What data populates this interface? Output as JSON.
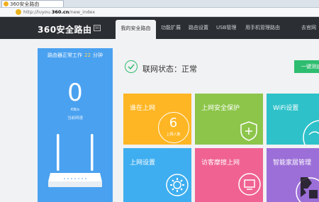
{
  "browser": {
    "tab_title": "360安全路由",
    "url_prefix": "http://luyou.",
    "url_domain": "360.cn",
    "url_path": "/new_index"
  },
  "header": {
    "logo_text": "360安全路由",
    "version_badge": "90",
    "nav": [
      "我的安全路由",
      "功能扩展",
      "路由设置",
      "USB管理",
      "用手机管理路由"
    ],
    "active_nav_index": 0,
    "user_link": "去官网"
  },
  "status": {
    "run_label": "路由器正常工作",
    "run_minutes": "22",
    "run_unit": "分钟",
    "speed_value": "0",
    "speed_unit": "KB/s",
    "speed_label": "当前网速"
  },
  "connection": {
    "label": "联网状态：正常",
    "action_button": "一键测速"
  },
  "tiles": [
    {
      "label": "谁在上网",
      "count": "6",
      "count_label": "上网人数",
      "color": "#ffb624"
    },
    {
      "label": "上网安全保护",
      "icon": "shield-plus-icon",
      "color": "#8cc54a"
    },
    {
      "label": "WiFi设置",
      "icon": "wifi-icon",
      "color": "#2ec1c9"
    },
    {
      "label": "上网设置",
      "icon": "gear-icon",
      "color": "#3eaef0"
    },
    {
      "label": "访客摩擦上网",
      "icon": "monitor-icon",
      "color": "#f06292"
    },
    {
      "label": "智能家居管理",
      "icon": "smart-home-icon",
      "color": "#9c6fd8"
    }
  ]
}
